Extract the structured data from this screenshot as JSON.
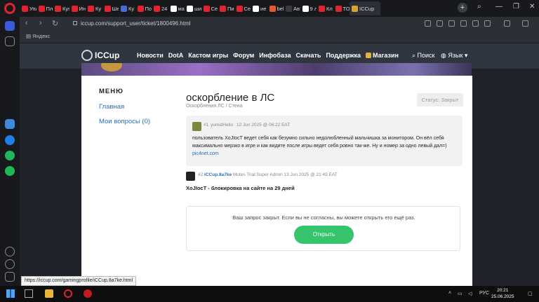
{
  "browser": {
    "tabs": [
      {
        "label": "Упл",
        "color": "#e0232e"
      },
      {
        "label": "Пл",
        "color": "#e0232e"
      },
      {
        "label": "Куп",
        "color": "#e0232e"
      },
      {
        "label": "Ин",
        "color": "#e0232e"
      },
      {
        "label": "Ку",
        "color": "#e0232e"
      },
      {
        "label": "Ше",
        "color": "#e0232e"
      },
      {
        "label": "Ку",
        "color": "#4a6cd4"
      },
      {
        "label": "По",
        "color": "#e0232e"
      },
      {
        "label": "24",
        "color": "#e0232e"
      },
      {
        "label": "ма",
        "color": "#ffffff"
      },
      {
        "label": "ши",
        "color": "#ffffff"
      },
      {
        "label": "Се",
        "color": "#e0232e"
      },
      {
        "label": "Пи",
        "color": "#e0232e"
      },
      {
        "label": "Се",
        "color": "#e0232e"
      },
      {
        "label": "ие",
        "color": "#ffffff"
      },
      {
        "label": "bel",
        "color": "#e05a2e"
      },
      {
        "label": "Авт",
        "color": "#3a3a3a"
      },
      {
        "label": "9 л",
        "color": "#ffffff"
      },
      {
        "label": "Кл",
        "color": "#e0232e"
      },
      {
        "label": "ТО",
        "color": "#e0232e"
      }
    ],
    "active_tab": {
      "label": "ICCup",
      "color": "#d8a233"
    },
    "new_tab": "+",
    "url": "iccup.com/support_user/ticket/1800496.html",
    "bookmark": "Яндекс",
    "status_url": "https://iccup.com/gamingprofile/iCCup.8a7ke.html"
  },
  "site": {
    "logo": "ICCup",
    "nav": [
      "Новости",
      "DotA",
      "Кастом игры",
      "Форум",
      "Инфобаза",
      "Скачать",
      "Поддержка"
    ],
    "shop": "Магазин",
    "search": "Поиск",
    "lang": "Язык"
  },
  "menu": {
    "title": "МЕНЮ",
    "items": [
      "Главная",
      "Мои вопросы (0)"
    ]
  },
  "ticket": {
    "title": "оскорбление в ЛС",
    "subtitle": "Оскорбления ЛС / Стена",
    "status": "Статус: Закрыт",
    "messages": [
      {
        "num": "#1",
        "user": "yumidHello",
        "date": "12 Jun 2025 @ 06:22 EAT",
        "text": "пользователь XoJIocT ведет себя как безумно сильно недолюбленный мальчишка за монитором. Он вёл себя максимально мерзко в игре и как видите после игры ведет себя ровно так-же. Ну и номер за одно левый дал=)",
        "link": "pic4net.com"
      },
      {
        "num": "#2",
        "user": "iCCup.8a7ke",
        "role": "Mutes Trial Super Admin",
        "date": "13 Jun 2025 @ 21:49 EAT",
        "text": "XoJIocT - блокировка на сайте на 29 дней"
      }
    ],
    "closed_text": "Ваш запрос закрыт. Если вы не согласны, вы можете открыть его ещё раз.",
    "open_button": "Открыть"
  },
  "taskbar": {
    "lang": "РУС",
    "time": "20:21",
    "date": "25.06.2025"
  }
}
